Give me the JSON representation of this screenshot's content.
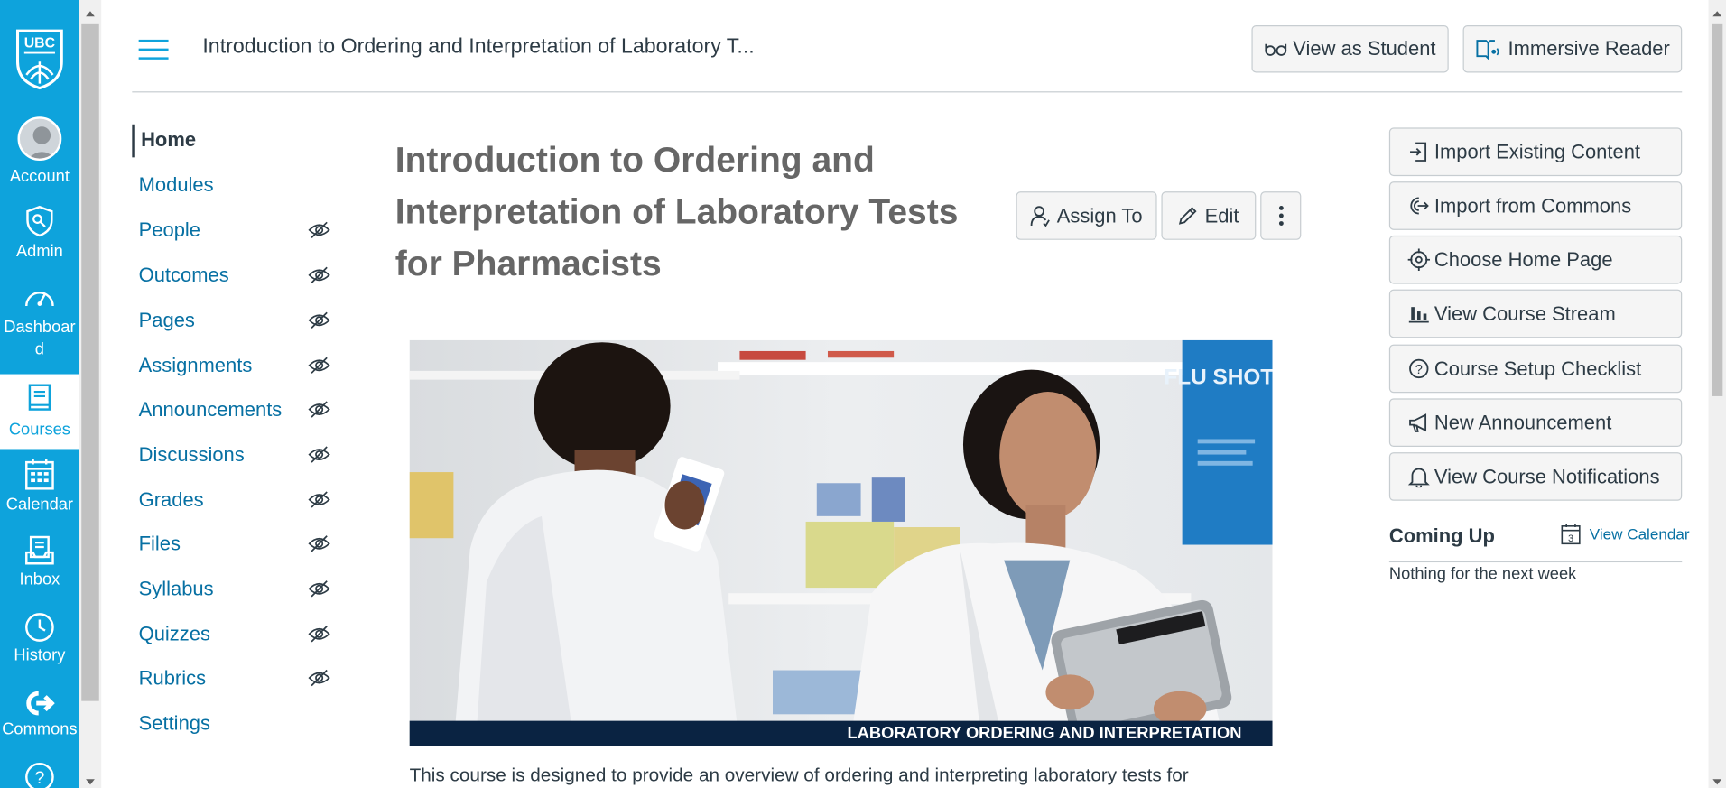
{
  "global_nav": {
    "logo_text": "UBC",
    "items": [
      {
        "label": "Account",
        "icon": "account-avatar"
      },
      {
        "label": "Admin",
        "icon": "shield-icon"
      },
      {
        "label": "Dashboard",
        "icon": "speedometer-icon"
      },
      {
        "label": "Courses",
        "icon": "book-icon"
      },
      {
        "label": "Calendar",
        "icon": "calendar-icon"
      },
      {
        "label": "Inbox",
        "icon": "inbox-icon"
      },
      {
        "label": "History",
        "icon": "clock-icon"
      },
      {
        "label": "Commons",
        "icon": "commons-icon"
      },
      {
        "label": "",
        "icon": "help-icon"
      }
    ],
    "active": "Courses",
    "color": "#0ea3dc"
  },
  "header": {
    "breadcrumb": "Introduction to Ordering and Interpretation of Laboratory T...",
    "view_as_student": "View as Student",
    "immersive_reader": "Immersive Reader"
  },
  "course_nav": {
    "items": [
      {
        "label": "Home",
        "active": true,
        "hidden": false
      },
      {
        "label": "Modules",
        "hidden": false
      },
      {
        "label": "People",
        "hidden": true
      },
      {
        "label": "Outcomes",
        "hidden": true
      },
      {
        "label": "Pages",
        "hidden": true
      },
      {
        "label": "Assignments",
        "hidden": true
      },
      {
        "label": "Announcements",
        "hidden": true
      },
      {
        "label": "Discussions",
        "hidden": true
      },
      {
        "label": "Grades",
        "hidden": true
      },
      {
        "label": "Files",
        "hidden": true
      },
      {
        "label": "Syllabus",
        "hidden": true
      },
      {
        "label": "Quizzes",
        "hidden": true
      },
      {
        "label": "Rubrics",
        "hidden": true
      },
      {
        "label": "Settings",
        "hidden": false
      }
    ]
  },
  "main": {
    "title": "Introduction to Ordering and Interpretation of Laboratory Tests for Pharmacists",
    "assign_to": "Assign To",
    "edit": "Edit",
    "banner_text": "LABORATORY ORDERING AND INTERPRETATION",
    "poster_text": "FLU SHOTS",
    "intro": "This course is designed to provide an overview of ordering and interpreting laboratory tests for"
  },
  "sidebar": {
    "buttons": [
      {
        "label": "Import Existing Content",
        "icon": "import-icon"
      },
      {
        "label": "Import from Commons",
        "icon": "commons-icon"
      },
      {
        "label": "Choose Home Page",
        "icon": "target-icon"
      },
      {
        "label": "View Course Stream",
        "icon": "bar-chart-icon"
      },
      {
        "label": "Course Setup Checklist",
        "icon": "question-icon"
      },
      {
        "label": "New Announcement",
        "icon": "megaphone-icon"
      },
      {
        "label": "View Course Notifications",
        "icon": "bell-icon"
      }
    ],
    "coming_up": "Coming Up",
    "view_calendar": "View Calendar",
    "calendar_day": "3",
    "nothing": "Nothing for the next week"
  }
}
